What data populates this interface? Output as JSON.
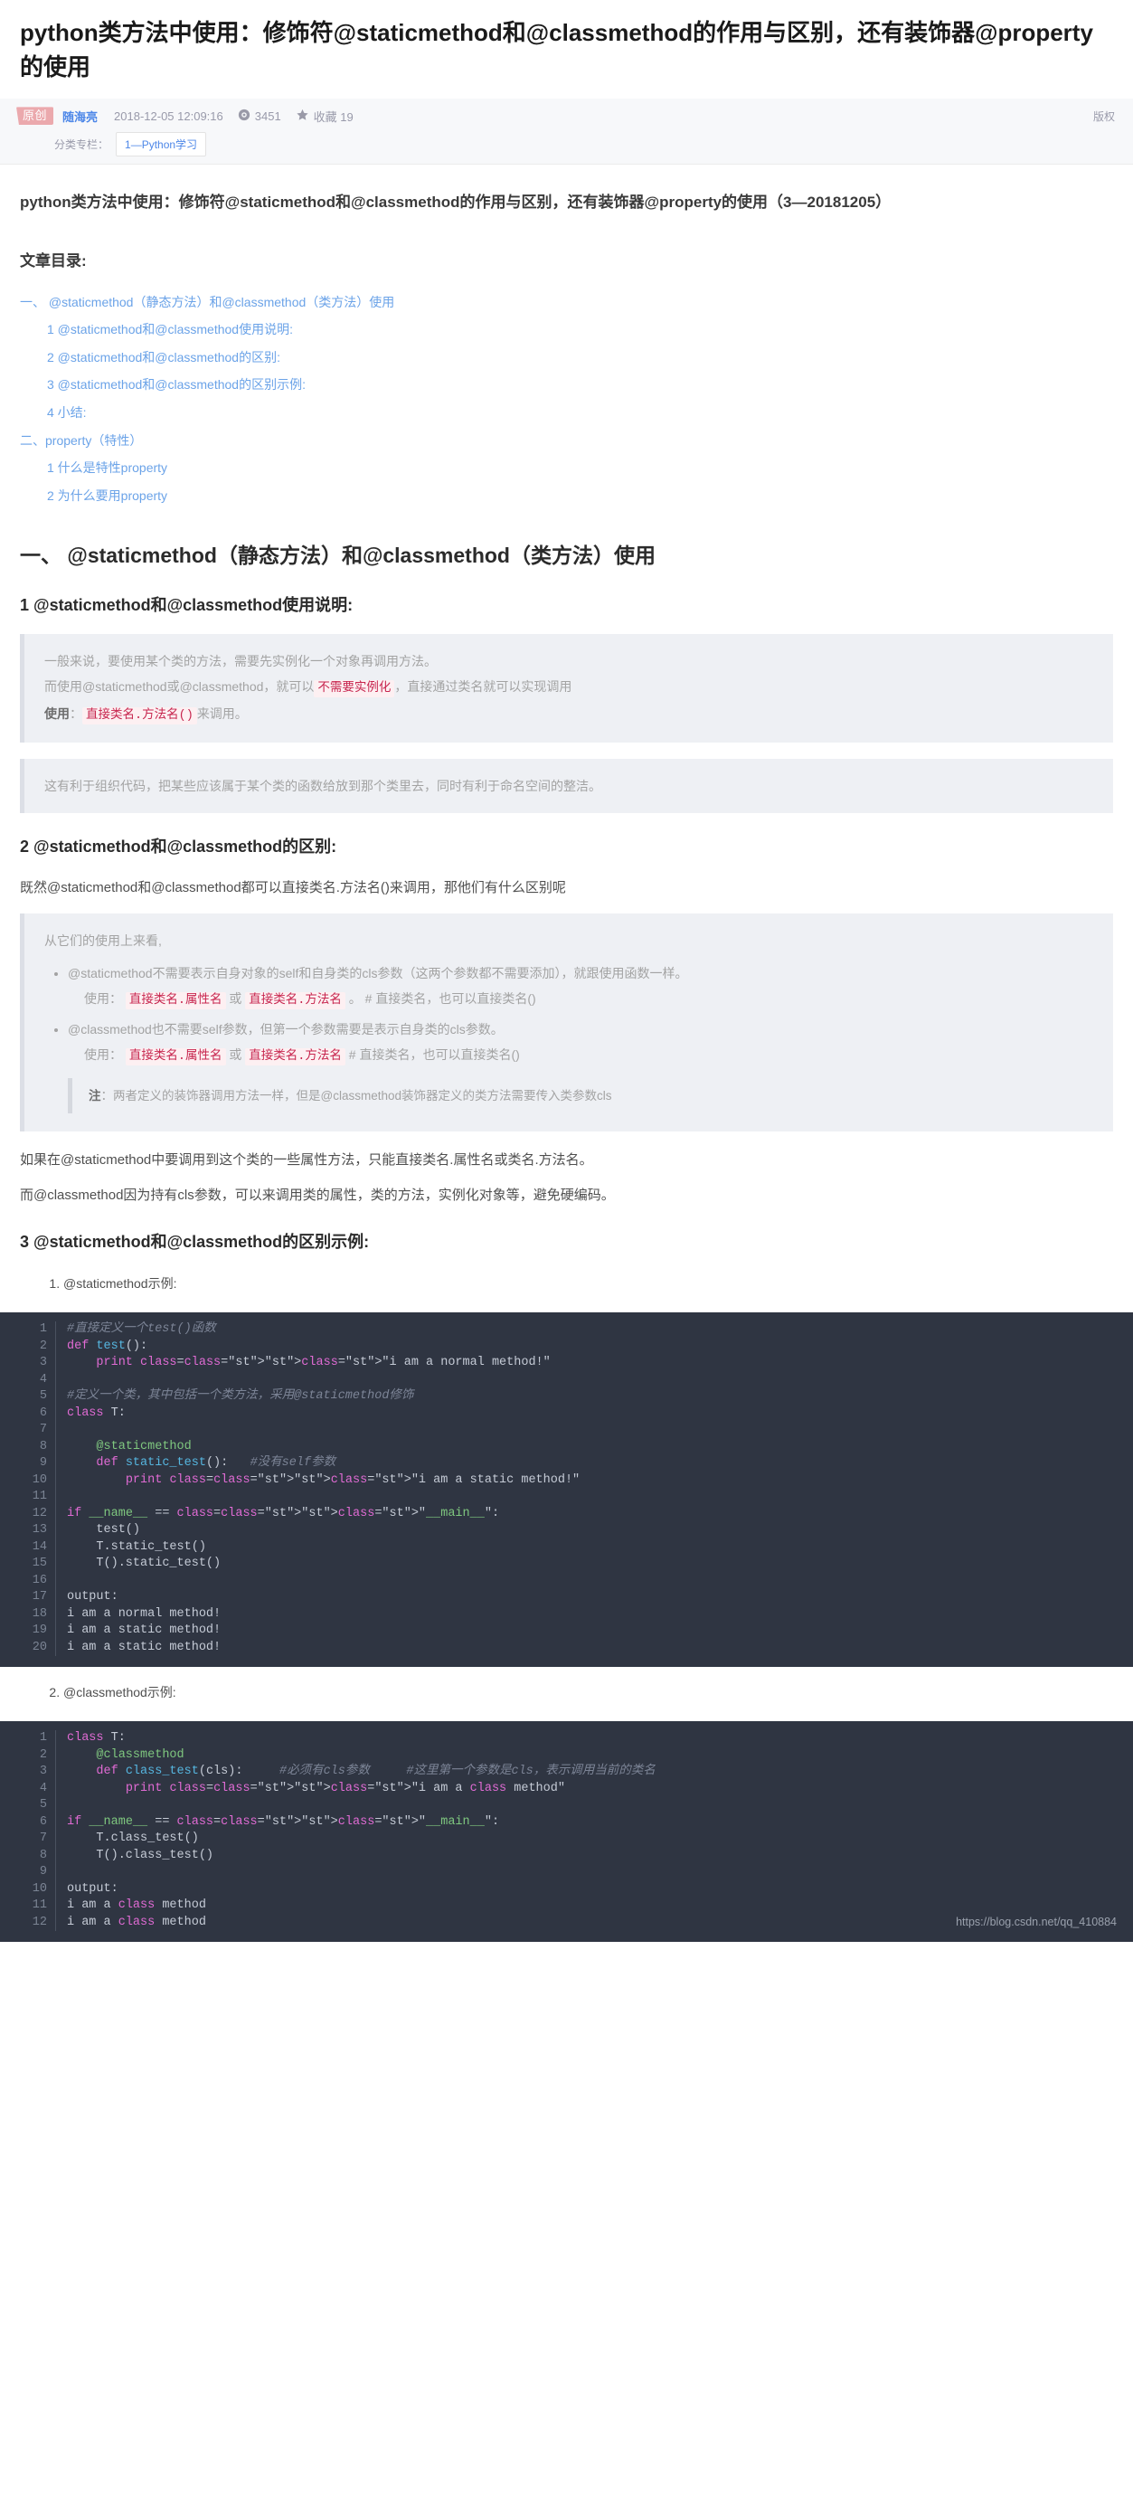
{
  "article": {
    "title": "python类方法中使用：修饰符@staticmethod和@classmethod的作用与区别，还有装饰器@property的使用",
    "badge": "原创",
    "author": "随海亮",
    "pubtime": "2018-12-05 12:09:16",
    "views": "3451",
    "favorites_label": "收藏 19",
    "copyright_label": "版权",
    "column_label": "分类专栏：",
    "column_value": "1—Python学习",
    "view_icon": "eye-icon",
    "star_icon": "star-icon"
  },
  "body": {
    "subtitle": "python类方法中使用：修饰符@staticmethod和@classmethod的作用与区别，还有装饰器@property的使用（3—20181205）",
    "toc_title": "文章目录:",
    "toc": [
      {
        "level": 0,
        "label": "一、 @staticmethod（静态方法）和@classmethod（类方法）使用"
      },
      {
        "level": 1,
        "label": "1 @staticmethod和@classmethod使用说明:"
      },
      {
        "level": 1,
        "label": "2 @staticmethod和@classmethod的区别:"
      },
      {
        "level": 1,
        "label": "3 @staticmethod和@classmethod的区别示例:"
      },
      {
        "level": 1,
        "label": "4 小结:"
      },
      {
        "level": 0,
        "label": "二、property（特性）"
      },
      {
        "level": 1,
        "label": "1 什么是特性property"
      },
      {
        "level": 1,
        "label": "2 为什么要用property"
      }
    ],
    "h1_section": "一、 @staticmethod（静态方法）和@classmethod（类方法）使用",
    "h2_one": "1 @staticmethod和@classmethod使用说明:",
    "note1": {
      "line1": "一般来说，要使用某个类的方法，需要先实例化一个对象再调用方法。",
      "line2_a": "而使用@staticmethod或@classmethod，就可以",
      "line2_code": "不需要实例化",
      "line2_b": "，直接通过类名就可以实现调用",
      "line3_label": "使用",
      "line3_sep": "：",
      "line3_code": "直接类名.方法名()",
      "line3_tail": "来调用。"
    },
    "note2": "这有利于组织代码，把某些应该属于某个类的函数给放到那个类里去，同时有利于命名空间的整洁。",
    "h2_two": "2 @staticmethod和@classmethod的区别:",
    "para_after_h2two": "既然@staticmethod和@classmethod都可以直接类名.方法名()来调用，那他们有什么区别呢",
    "note3": {
      "intro": "从它们的使用上来看,",
      "bullet1": "@staticmethod不需要表示自身对象的self和自身类的cls参数（这两个参数都不需要添加），就跟使用函数一样。",
      "bullet1_use_label": "使用：",
      "bullet1_code1": "直接类名.属性名",
      "bullet1_or": "或",
      "bullet1_code2": "直接类名.方法名",
      "bullet1_tail": "。 # 直接类名，也可以直接类名()",
      "bullet2": "@classmethod也不需要self参数，但第一个参数需要是表示自身类的cls参数。",
      "bullet2_use_label": "使用：",
      "bullet2_code1": "直接类名.属性名",
      "bullet2_or": "或",
      "bullet2_code2": "直接类名.方法名",
      "bullet2_tail": "# 直接类名，也可以直接类名()",
      "inner_label": "注",
      "inner_sep": "：",
      "inner_text": "两者定义的装饰器调用方法一样，但是@classmethod装饰器定义的类方法需要传入类参数cls"
    },
    "para_tail1": "如果在@staticmethod中要调用到这个类的一些属性方法，只能直接类名.属性名或类名.方法名。",
    "para_tail2": "而@classmethod因为持有cls参数，可以来调用类的属性，类的方法，实例化对象等，避免硬编码。",
    "h2_three": "3 @staticmethod和@classmethod的区别示例:",
    "example1_label": "@staticmethod示例:",
    "example2_label": "@classmethod示例:"
  },
  "code1": {
    "lines": [
      "1",
      "2",
      "3",
      "4",
      "5",
      "6",
      "7",
      "8",
      "9",
      "10",
      "11",
      "12",
      "13",
      "14",
      "15",
      "16",
      "17",
      "18",
      "19",
      "20"
    ],
    "source": [
      "#直接定义一个test()函数",
      "def test():",
      "    print \"i am a normal method!\"",
      "",
      "#定义一个类，其中包括一个类方法，采用@staticmethod修饰",
      "class T:",
      "",
      "    @staticmethod",
      "    def static_test():   #没有self参数",
      "        print \"i am a static method!\"",
      "",
      "if __name__ == \"__main__\":",
      "    test()",
      "    T.static_test()",
      "    T().static_test()",
      "",
      "output:",
      "i am a normal method!",
      "i am a static method!",
      "i am a static method!"
    ]
  },
  "code2": {
    "lines": [
      "1",
      "2",
      "3",
      "4",
      "5",
      "6",
      "7",
      "8",
      "9",
      "10",
      "11",
      "12"
    ],
    "source": [
      "class T:",
      "    @classmethod",
      "    def class_test(cls):     #必须有cls参数     #这里第一个参数是cls，表示调用当前的类名",
      "        print \"i am a class method\"",
      "",
      "if __name__ == \"__main__\":",
      "    T.class_test()",
      "    T().class_test()",
      "",
      "output:",
      "i am a class method",
      "i am a class method"
    ]
  },
  "watermark": "https://blog.csdn.net/qq_410884"
}
